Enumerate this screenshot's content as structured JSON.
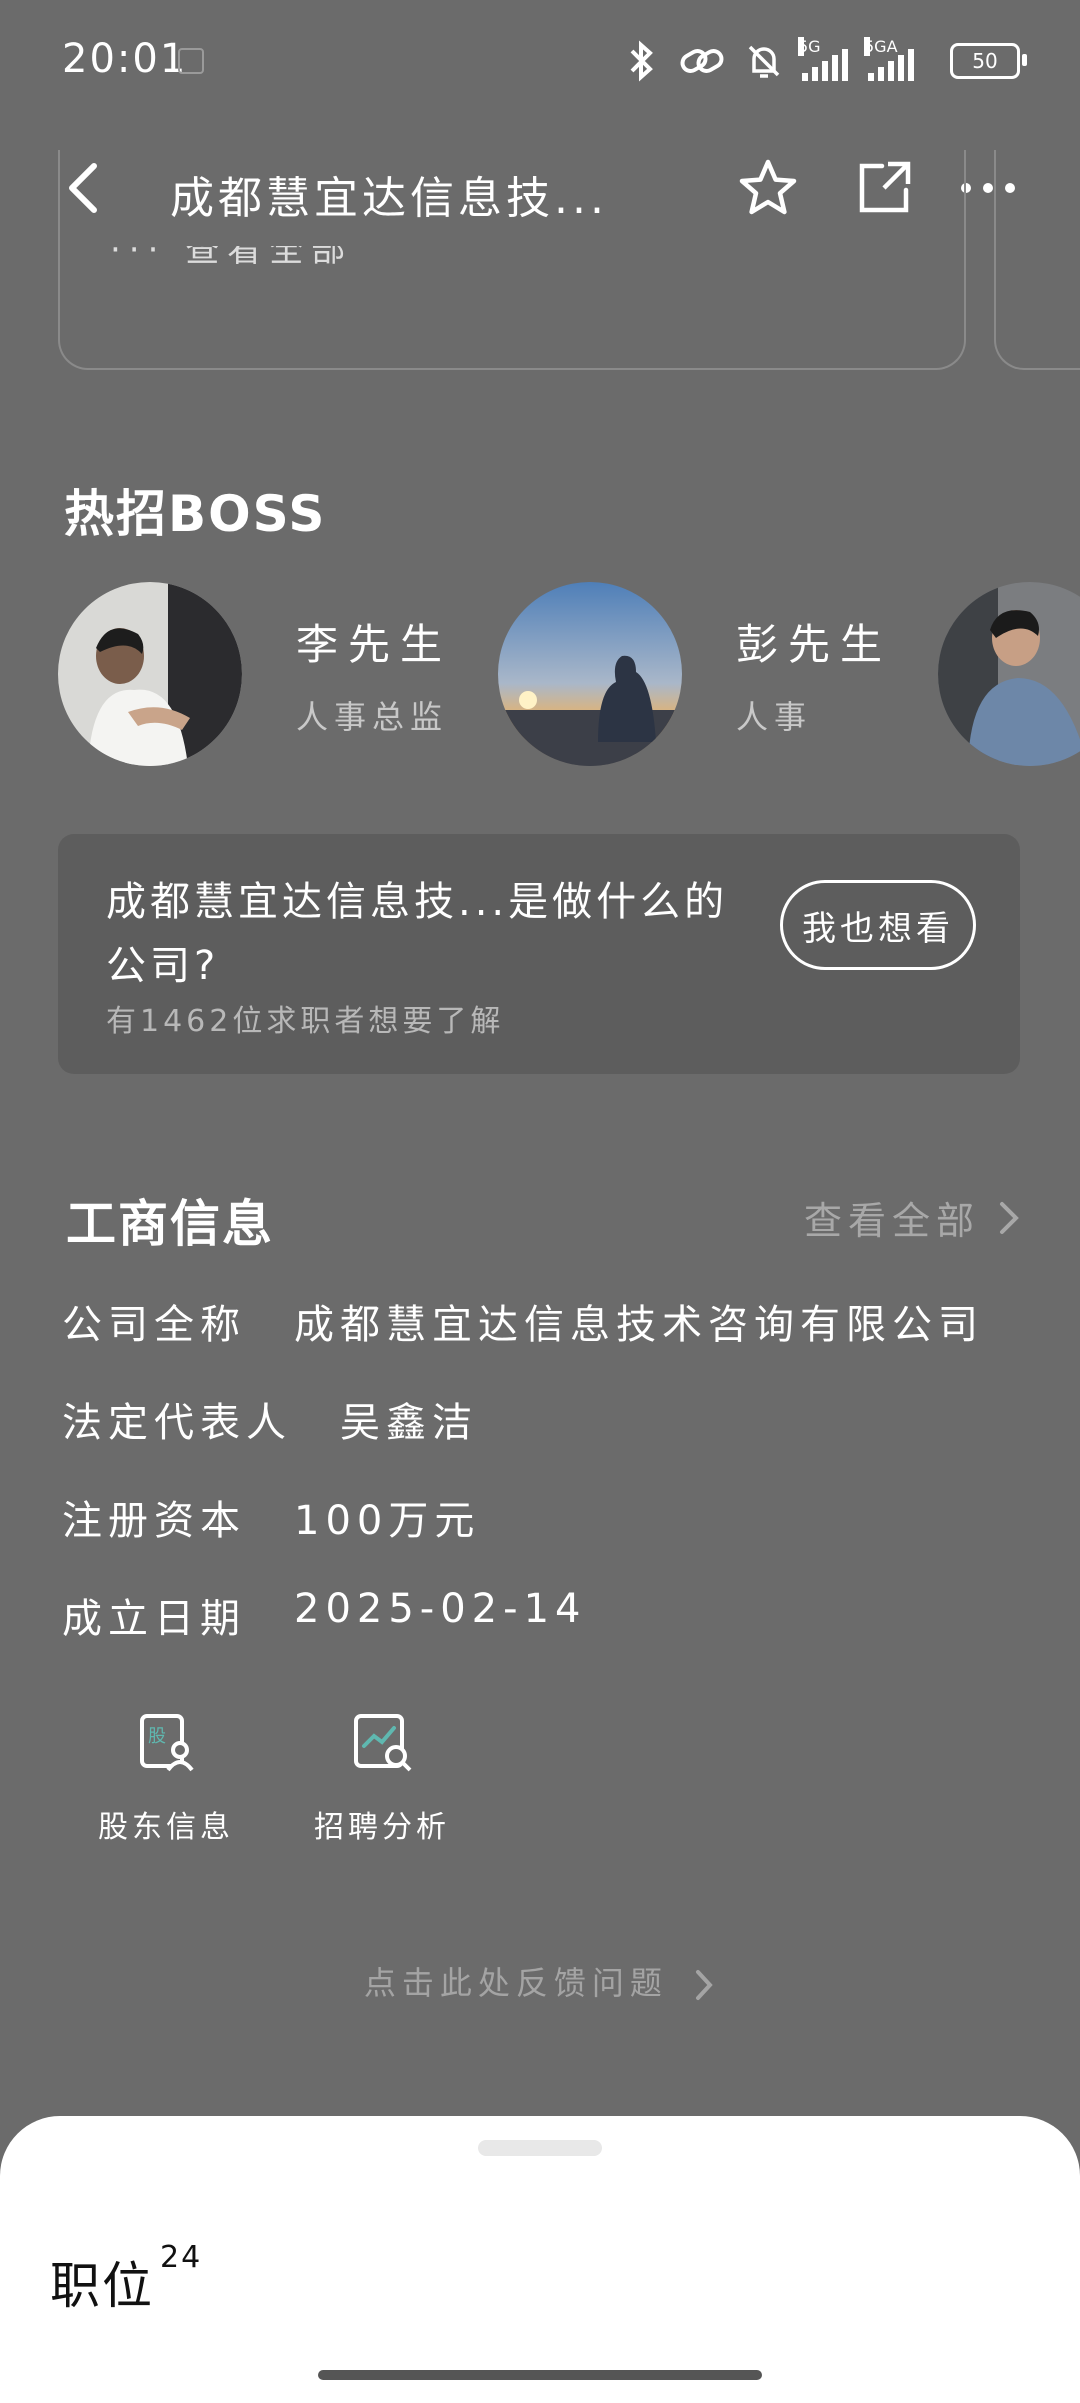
{
  "status": {
    "time": "20:01",
    "net1": "5G",
    "net2": "5GA",
    "battery": "50"
  },
  "header": {
    "title": "成都慧宜达信息技..."
  },
  "prev_card": {
    "text_fragment": "··· 查看全部"
  },
  "hot_boss": {
    "title": "热招BOSS",
    "bosses": [
      {
        "name": "李先生",
        "role": "人事总监"
      },
      {
        "name": "彭先生",
        "role": "人事"
      }
    ]
  },
  "qa": {
    "question": "成都慧宜达信息技...是做什么的公司?",
    "sub": "有1462位求职者想要了解",
    "button": "我也想看"
  },
  "business": {
    "title": "工商信息",
    "view_all": "查看全部",
    "rows": [
      {
        "label": "公司全称",
        "value": "成都慧宜达信息技术咨询有限公司"
      },
      {
        "label": "法定代表人",
        "value": "吴鑫洁"
      },
      {
        "label": "注册资本",
        "value": "100万元"
      },
      {
        "label": "成立日期",
        "value": "2025-02-14"
      }
    ],
    "tools": [
      {
        "label": "股东信息",
        "icon_char": "股"
      },
      {
        "label": "招聘分析"
      }
    ]
  },
  "feedback": "点击此处反馈问题",
  "sheet": {
    "title": "职位",
    "count": "24"
  },
  "colors": {
    "background": "#6b6b6b",
    "accent": "#5fb8b0",
    "sheet": "#ffffff"
  }
}
